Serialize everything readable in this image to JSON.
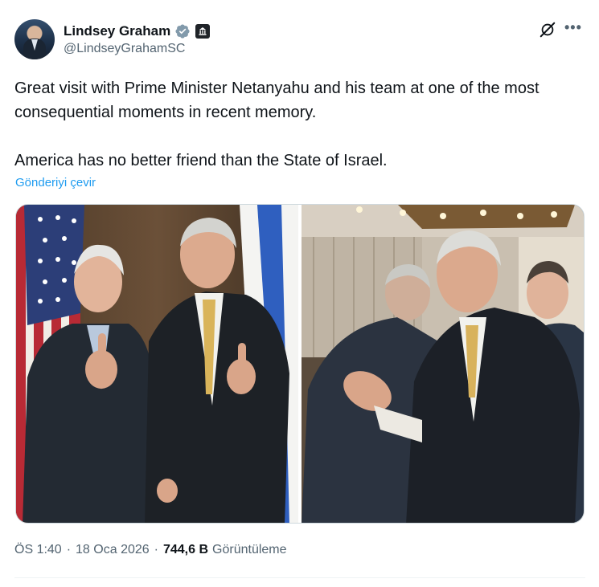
{
  "author": {
    "display_name": "Lindsey Graham",
    "handle": "@LindseyGrahamSC",
    "verified": true,
    "verified_color": "#829aab",
    "avatar_icon": "profile-photo",
    "affiliation_icon": "government-badge-icon"
  },
  "post": {
    "paragraphs": [
      "Great visit with Prime Minister Netanyahu and his team at one of the most consequential moments in recent memory.",
      "America has no better friend than the State of Israel."
    ],
    "translate_label": "Gönderiyi çevir",
    "link_color": "#1d9bf0"
  },
  "media": {
    "count": 2,
    "items": [
      "photo-thumbs-up",
      "photo-embrace"
    ]
  },
  "meta": {
    "time": "ÖS 1:40",
    "separator": "·",
    "date": "18 Oca 2026",
    "views_count": "744,6 B",
    "views_label": "Görüntüleme"
  },
  "actions": {
    "grok_icon": "grok-icon",
    "more_icon": "more-icon"
  }
}
